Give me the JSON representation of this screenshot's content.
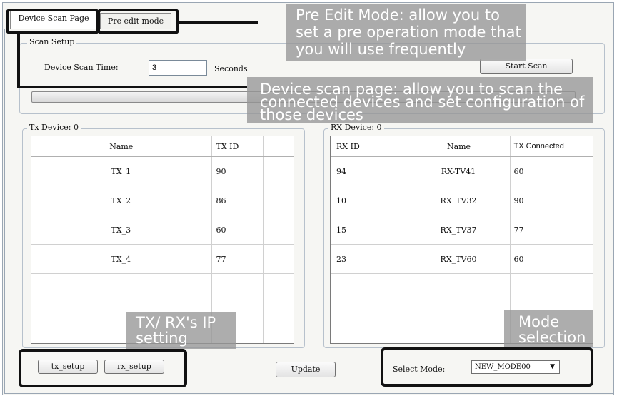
{
  "tabs": [
    "Device Scan Page",
    "Pre edit mode"
  ],
  "scan_setup": {
    "legend": "Scan Setup",
    "label": "Device Scan Time:",
    "value": "3",
    "unit": "Seconds",
    "start_button": "Start Scan"
  },
  "tx_panel": {
    "legend": "Tx Device: 0",
    "columns": [
      "Name",
      "TX ID",
      ""
    ],
    "rows": [
      [
        "TX_1",
        "90"
      ],
      [
        "TX_2",
        "86"
      ],
      [
        "TX_3",
        "60"
      ],
      [
        "TX_4",
        "77"
      ],
      [
        "",
        ""
      ],
      [
        "",
        ""
      ],
      [
        "",
        ""
      ]
    ]
  },
  "rx_panel": {
    "legend": "RX Device: 0",
    "columns": [
      "RX ID",
      "Name",
      "TX Connected"
    ],
    "rows": [
      [
        "94",
        "RX-TV41",
        "60"
      ],
      [
        "10",
        "RX_TV32",
        "90"
      ],
      [
        "15",
        "RX_TV37",
        "77"
      ],
      [
        "23",
        "RX_TV60",
        "60"
      ],
      [
        "",
        "",
        ""
      ],
      [
        "",
        "",
        ""
      ],
      [
        "",
        "",
        ""
      ]
    ]
  },
  "bottom": {
    "tx_setup": "tx_setup",
    "rx_setup": "rx_setup",
    "update": "Update",
    "select_label": "Select Mode:",
    "select_value": "NEW_MODE00"
  },
  "callouts": {
    "pre_edit": "Pre Edit Mode: allow you to set a pre operation mode that you will use frequently",
    "scan_page": "Device scan page:  allow you to scan the connected devices and set configuration of those devices",
    "ip_setting": "TX/ RX's IP setting",
    "mode_selection": "Mode selection"
  },
  "icons": {
    "dropdown": "chevron-down-icon"
  }
}
